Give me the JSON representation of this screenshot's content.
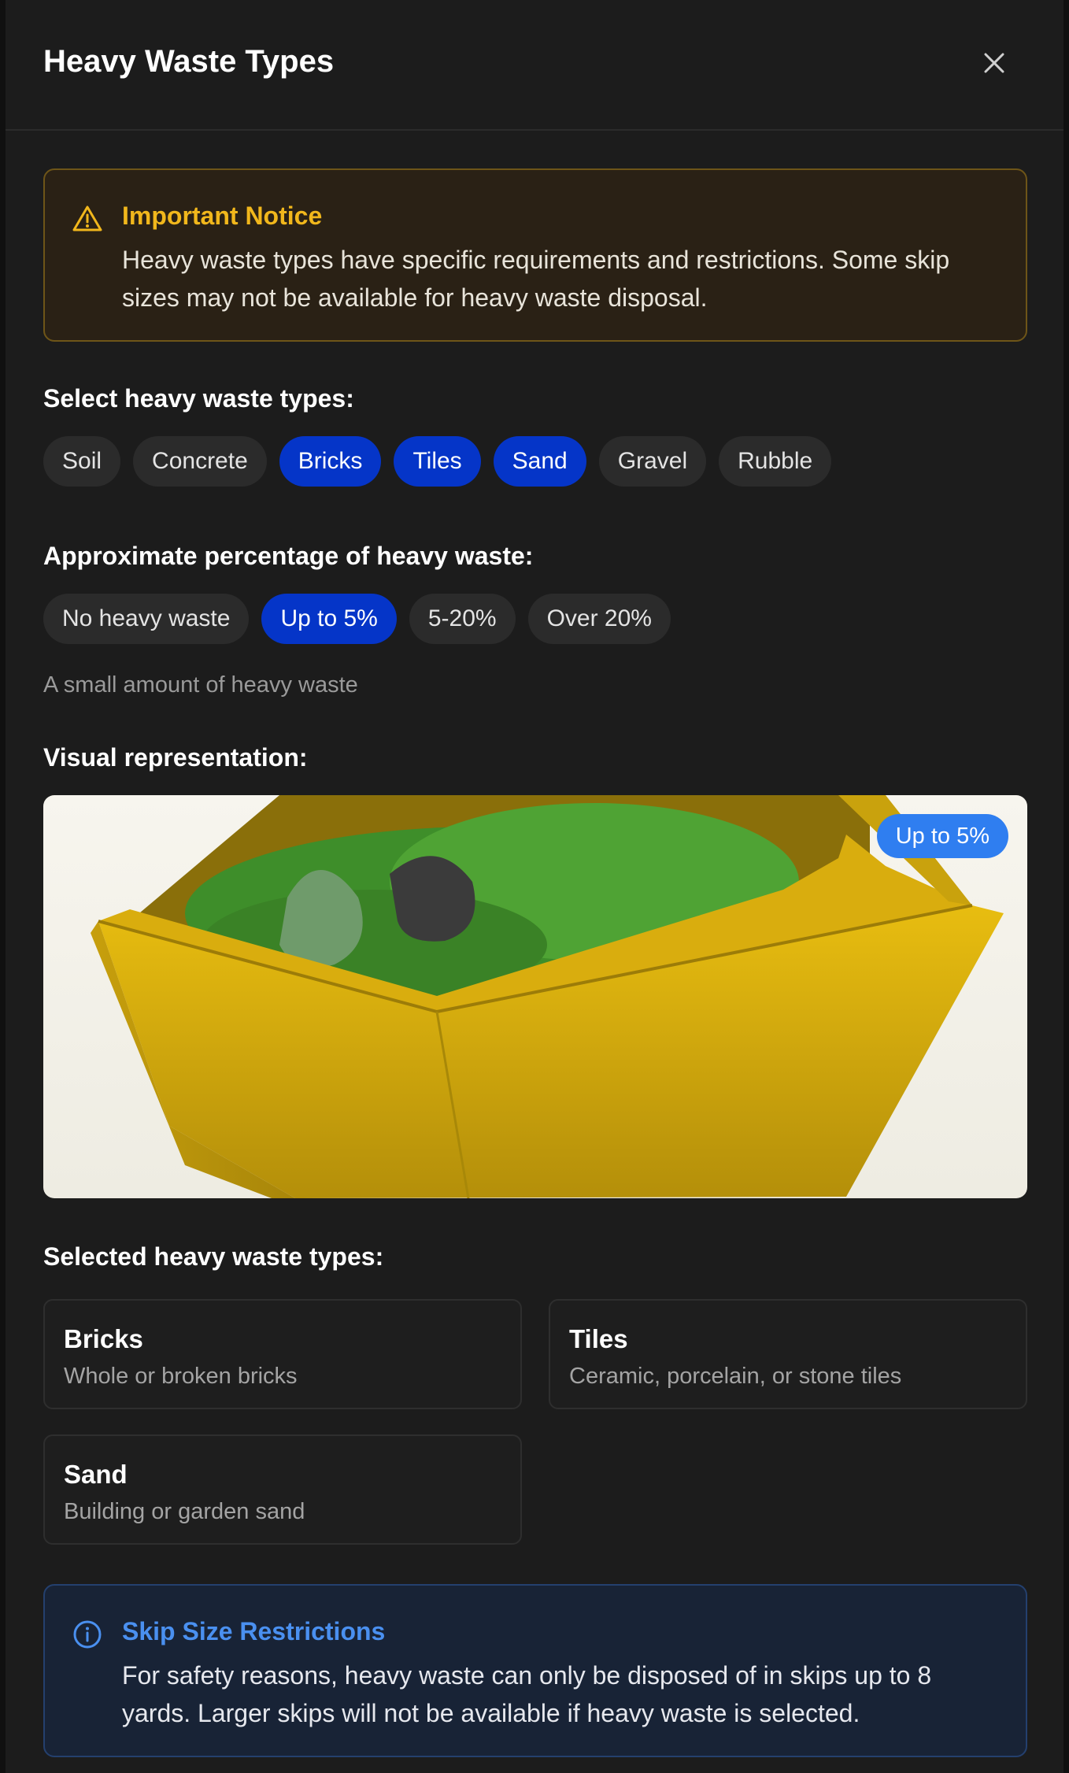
{
  "modal": {
    "title": "Heavy Waste Types"
  },
  "notice": {
    "title": "Important Notice",
    "text": "Heavy waste types have specific requirements and restrictions. Some skip sizes may not be available for heavy waste disposal.",
    "icon": "warning-triangle-icon",
    "color": "#f1b71c"
  },
  "waste_types": {
    "label": "Select heavy waste types:",
    "options": [
      {
        "label": "Soil",
        "selected": false
      },
      {
        "label": "Concrete",
        "selected": false
      },
      {
        "label": "Bricks",
        "selected": true
      },
      {
        "label": "Tiles",
        "selected": true
      },
      {
        "label": "Sand",
        "selected": true
      },
      {
        "label": "Gravel",
        "selected": false
      },
      {
        "label": "Rubble",
        "selected": false
      }
    ]
  },
  "percentage": {
    "label": "Approximate percentage of heavy waste:",
    "options": [
      {
        "label": "No heavy waste",
        "selected": false
      },
      {
        "label": "Up to 5%",
        "selected": true
      },
      {
        "label": "5-20%",
        "selected": false
      },
      {
        "label": "Over 20%",
        "selected": false
      }
    ],
    "description": "A small amount of heavy waste"
  },
  "visual": {
    "label": "Visual representation:",
    "badge": "Up to 5%"
  },
  "selected": {
    "label": "Selected heavy waste types:",
    "items": [
      {
        "name": "Bricks",
        "description": "Whole or broken bricks"
      },
      {
        "name": "Tiles",
        "description": "Ceramic, porcelain, or stone tiles"
      },
      {
        "name": "Sand",
        "description": "Building or garden sand"
      }
    ]
  },
  "restrictions": {
    "title": "Skip Size Restrictions",
    "text": "For safety reasons, heavy waste can only be disposed of in skips up to 8 yards. Larger skips will not be available if heavy waste is selected.",
    "icon": "info-circle-icon",
    "color": "#4a90f0"
  },
  "colors": {
    "accent": "#0535c8",
    "badge": "#2f7ef0",
    "background": "#1c1c1c"
  }
}
